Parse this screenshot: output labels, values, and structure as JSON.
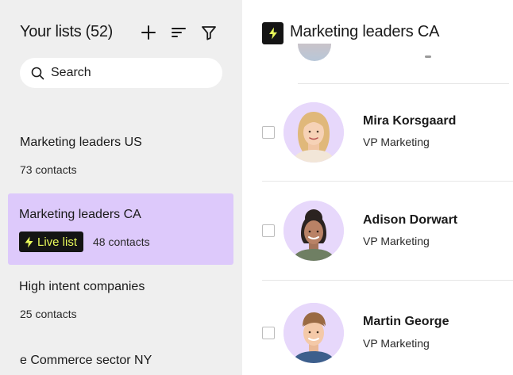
{
  "sidebar": {
    "title": "Your lists (52)",
    "search_placeholder": "Search",
    "icons": [
      "plus-icon",
      "sort-icon",
      "filter-icon"
    ],
    "lists": [
      {
        "name": "Marketing leaders US",
        "count": "73 contacts"
      },
      {
        "name": "Marketing leaders CA",
        "badge": "Live list",
        "count": "48 contacts",
        "active": true
      },
      {
        "name": "High intent companies",
        "count": "25 contacts"
      },
      {
        "name": "e Commerce sector NY"
      }
    ]
  },
  "main": {
    "title": "Marketing leaders CA",
    "contacts": [
      {
        "name": "Mira Korsgaard",
        "title": "VP Marketing"
      },
      {
        "name": "Adison Dorwart",
        "title": "VP Marketing"
      },
      {
        "name": "Martin George",
        "title": "VP Marketing"
      }
    ]
  },
  "colors": {
    "sidebar_bg": "#efefef",
    "active_item_bg": "#ddc9fb",
    "badge_bg": "#141414",
    "badge_text": "#e8f85a",
    "avatar_bg": "#e7d8fb"
  }
}
